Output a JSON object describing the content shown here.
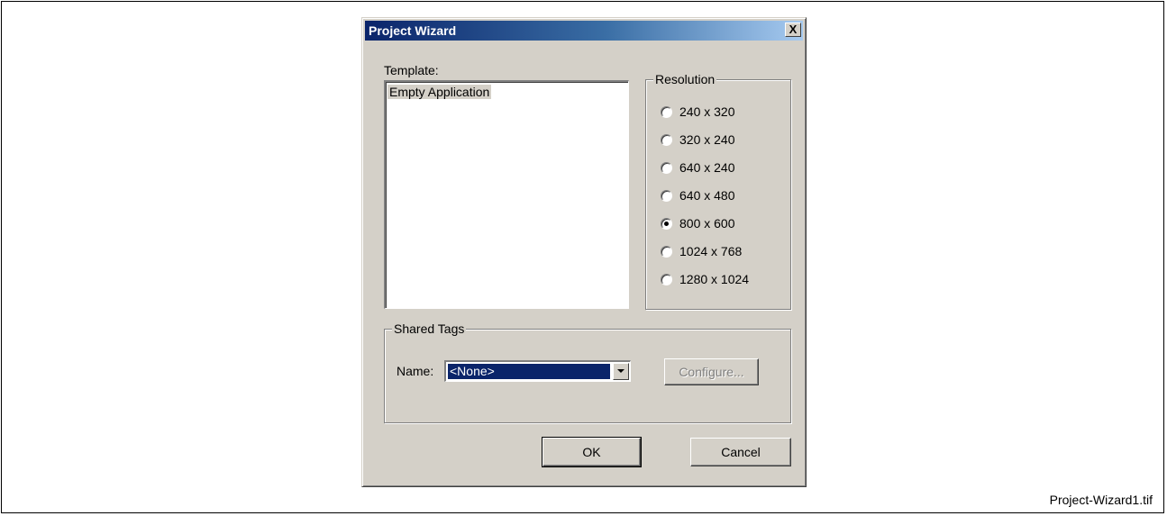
{
  "dialog": {
    "title": "Project Wizard",
    "close_label": "X",
    "template_label": "Template:",
    "templates": [
      "Empty Application"
    ],
    "resolution_group_label": "Resolution",
    "resolutions": [
      {
        "label": "240 x 320",
        "checked": false
      },
      {
        "label": "320 x 240",
        "checked": false
      },
      {
        "label": "640 x 240",
        "checked": false
      },
      {
        "label": "640 x 480",
        "checked": false
      },
      {
        "label": "800 x 600",
        "checked": true
      },
      {
        "label": "1024 x 768",
        "checked": false
      },
      {
        "label": "1280 x 1024",
        "checked": false
      }
    ],
    "shared_tags_label": "Shared Tags",
    "name_label": "Name:",
    "name_value": "<None>",
    "configure_label": "Configure...",
    "ok_label": "OK",
    "cancel_label": "Cancel"
  },
  "caption": "Project-Wizard1.tif",
  "colors": {
    "dialog_bg": "#d4d0c8",
    "title_gradient_start": "#0a246a",
    "title_gradient_end": "#a6caf0",
    "selection": "#0a246a"
  }
}
